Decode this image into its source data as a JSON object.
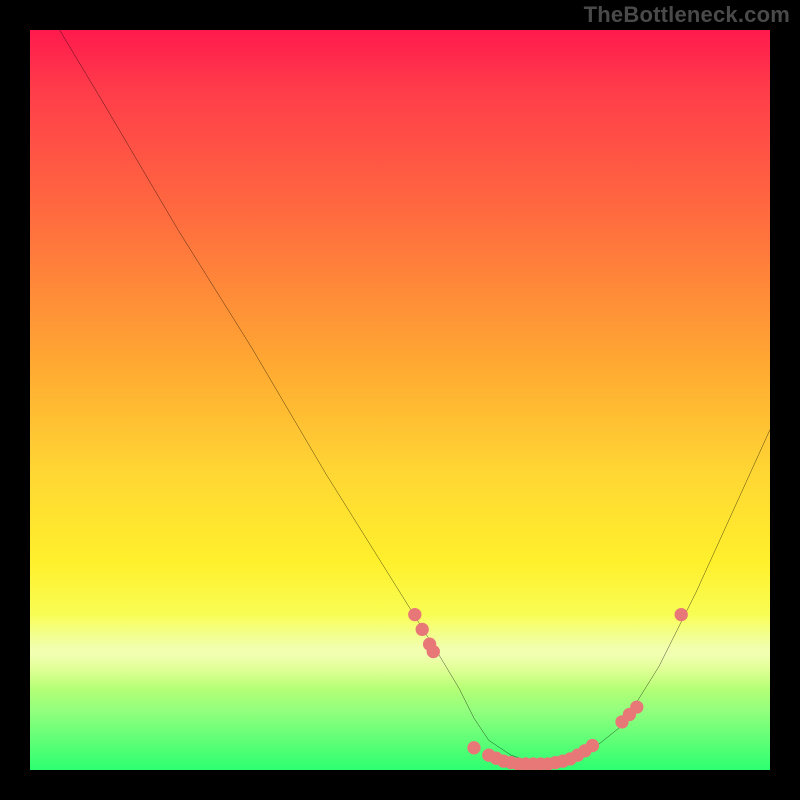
{
  "watermark": "TheBottleneck.com",
  "chart_data": {
    "type": "line",
    "title": "",
    "xlabel": "",
    "ylabel": "",
    "xlim": [
      0,
      100
    ],
    "ylim": [
      0,
      100
    ],
    "grid": false,
    "legend": false,
    "series": [
      {
        "name": "curve",
        "color": "#000000",
        "x": [
          4,
          10,
          20,
          30,
          40,
          50,
          55,
          58,
          60,
          62,
          65,
          68,
          70,
          72,
          75,
          80,
          85,
          90,
          95,
          100
        ],
        "y": [
          100,
          90,
          73,
          57,
          40,
          24,
          16,
          11,
          7,
          4,
          2,
          1,
          1,
          1,
          2,
          6,
          14,
          24,
          35,
          46
        ]
      }
    ],
    "markers": [
      {
        "name": "dots",
        "color": "#e87878",
        "x": [
          52,
          53,
          54,
          54.5,
          60,
          62,
          63,
          64,
          65,
          66,
          67,
          68,
          69,
          70,
          71,
          72,
          73,
          74,
          75,
          76,
          80,
          81,
          82,
          88
        ],
        "y": [
          21,
          19,
          17,
          16,
          3,
          2,
          1.6,
          1.2,
          1,
          0.8,
          0.8,
          0.8,
          0.8,
          0.8,
          1,
          1.2,
          1.5,
          2,
          2.6,
          3.3,
          6.5,
          7.5,
          8.5,
          21
        ]
      }
    ],
    "background_gradient": {
      "top": "#ff1a4d",
      "mid": "#ffe433",
      "bottom": "#2cff70"
    }
  }
}
